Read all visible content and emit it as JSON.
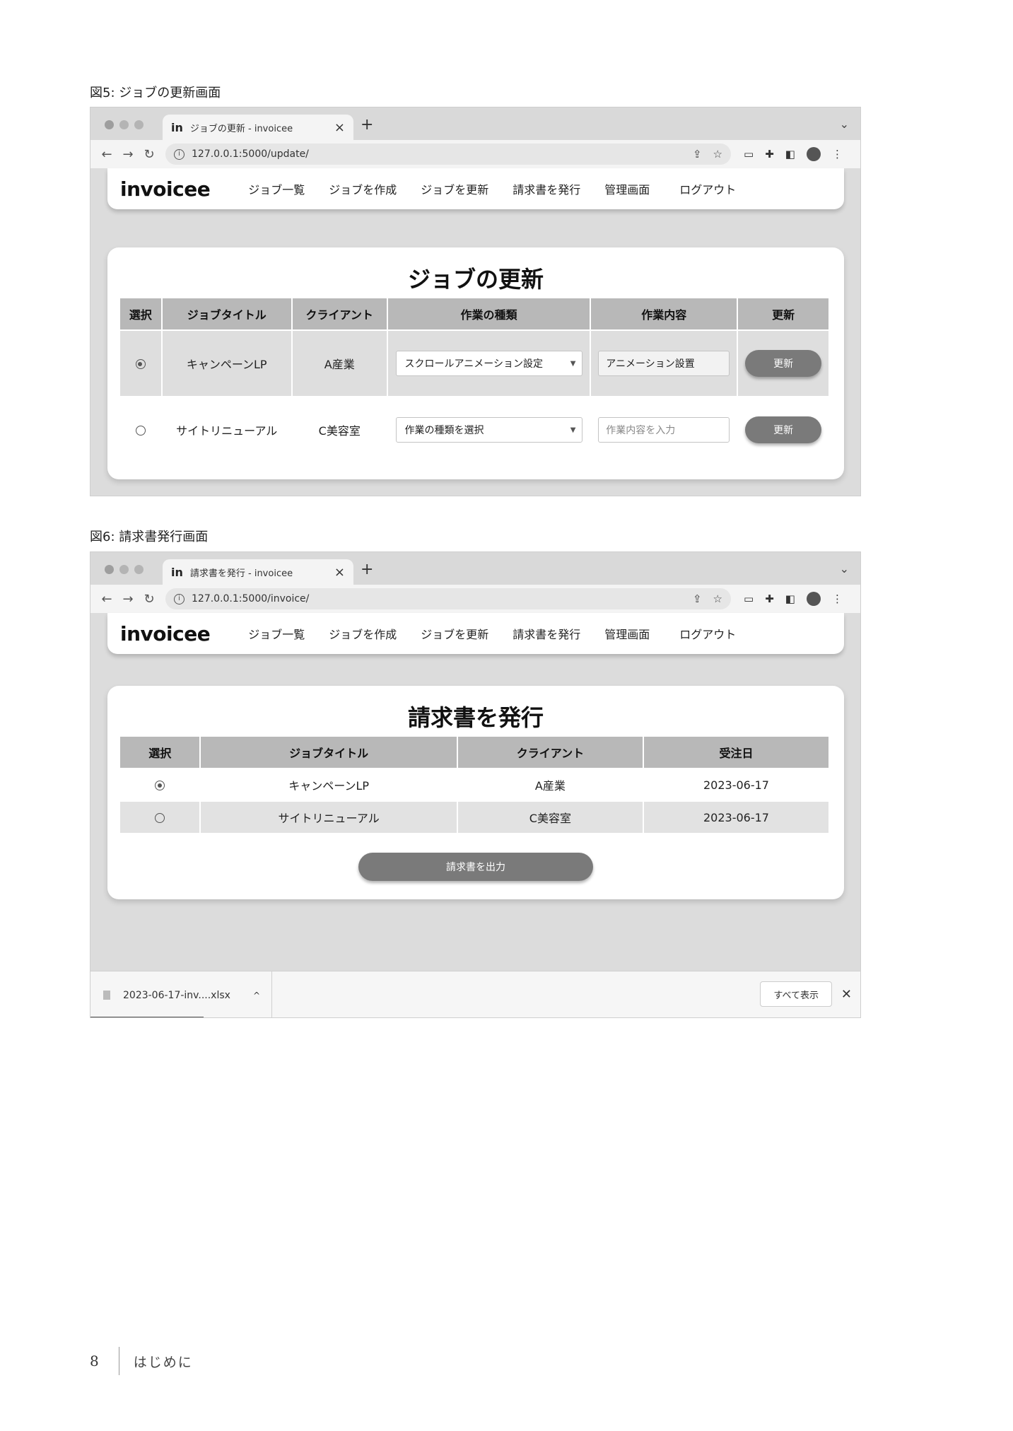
{
  "figure5": {
    "caption": "図5: ジョブの更新画面",
    "tab_title": "ジョブの更新 - invoicee",
    "url": "127.0.0.1:5000/update/",
    "app": {
      "logo": "invoicee",
      "nav": [
        "ジョブ一覧",
        "ジョブを作成",
        "ジョブを更新",
        "請求書を発行",
        "管理画面",
        "ログアウト"
      ]
    },
    "heading": "ジョブの更新",
    "columns": [
      "選択",
      "ジョブタイトル",
      "クライアント",
      "作業の種類",
      "作業内容",
      "更新"
    ],
    "rows": [
      {
        "selected": true,
        "title": "キャンペーンLP",
        "client": "A産業",
        "work_type": "スクロールアニメーション設定",
        "content": "アニメーション設置",
        "content_placeholder": "",
        "button": "更新"
      },
      {
        "selected": false,
        "title": "サイトリニューアル",
        "client": "C美容室",
        "work_type": "作業の種類を選択",
        "content": "",
        "content_placeholder": "作業内容を入力",
        "button": "更新"
      }
    ]
  },
  "figure6": {
    "caption": "図6: 請求書発行画面",
    "tab_title": "請求書を発行 - invoicee",
    "url": "127.0.0.1:5000/invoice/",
    "app": {
      "logo": "invoicee",
      "nav": [
        "ジョブ一覧",
        "ジョブを作成",
        "ジョブを更新",
        "請求書を発行",
        "管理画面",
        "ログアウト"
      ]
    },
    "heading": "請求書を発行",
    "columns": [
      "選択",
      "ジョブタイトル",
      "クライアント",
      "受注日"
    ],
    "rows": [
      {
        "selected": true,
        "title": "キャンペーンLP",
        "client": "A産業",
        "date": "2023-06-17"
      },
      {
        "selected": false,
        "title": "サイトリニューアル",
        "client": "C美容室",
        "date": "2023-06-17"
      }
    ],
    "issue_button": "請求書を出力",
    "download": {
      "filename": "2023-06-17-inv....xlsx",
      "show_all": "すべて表示"
    }
  },
  "footer": {
    "page_number": "8",
    "chapter": "はじめに"
  }
}
